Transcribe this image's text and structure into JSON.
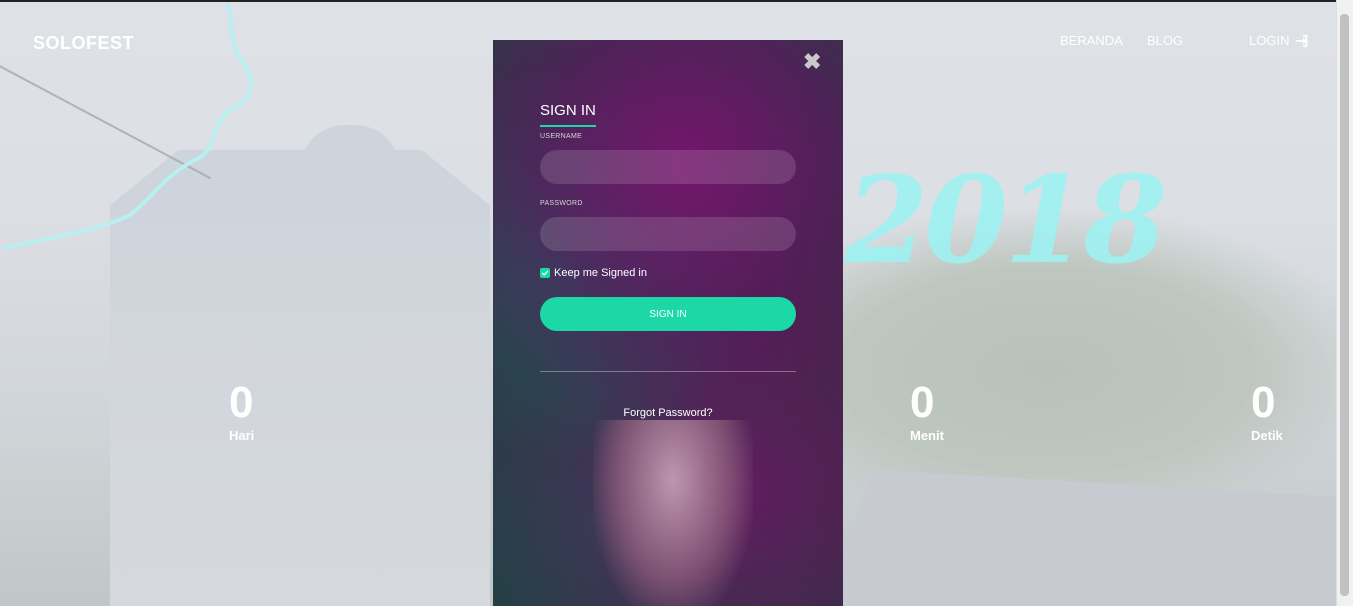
{
  "header": {
    "brand": "SOLOFEST",
    "nav": {
      "beranda": "BERANDA",
      "blog": "BLOG",
      "login": "LOGIN"
    }
  },
  "hero": {
    "year_text": "2018"
  },
  "countdown": [
    {
      "value": "0",
      "label": "Hari"
    },
    {
      "value": "0",
      "label": "Menit"
    },
    {
      "value": "0",
      "label": "Detik"
    }
  ],
  "modal": {
    "title": "SIGN IN",
    "username_label": "USERNAME",
    "username_value": "",
    "password_label": "PASSWORD",
    "password_value": "",
    "keep_signed_in": "Keep me Signed in",
    "keep_checked": true,
    "submit_label": "SIGN IN",
    "forgot_password": "Forgot Password?"
  },
  "colors": {
    "accent": "#1cd7a6",
    "year_text": "#9ef2f2"
  }
}
